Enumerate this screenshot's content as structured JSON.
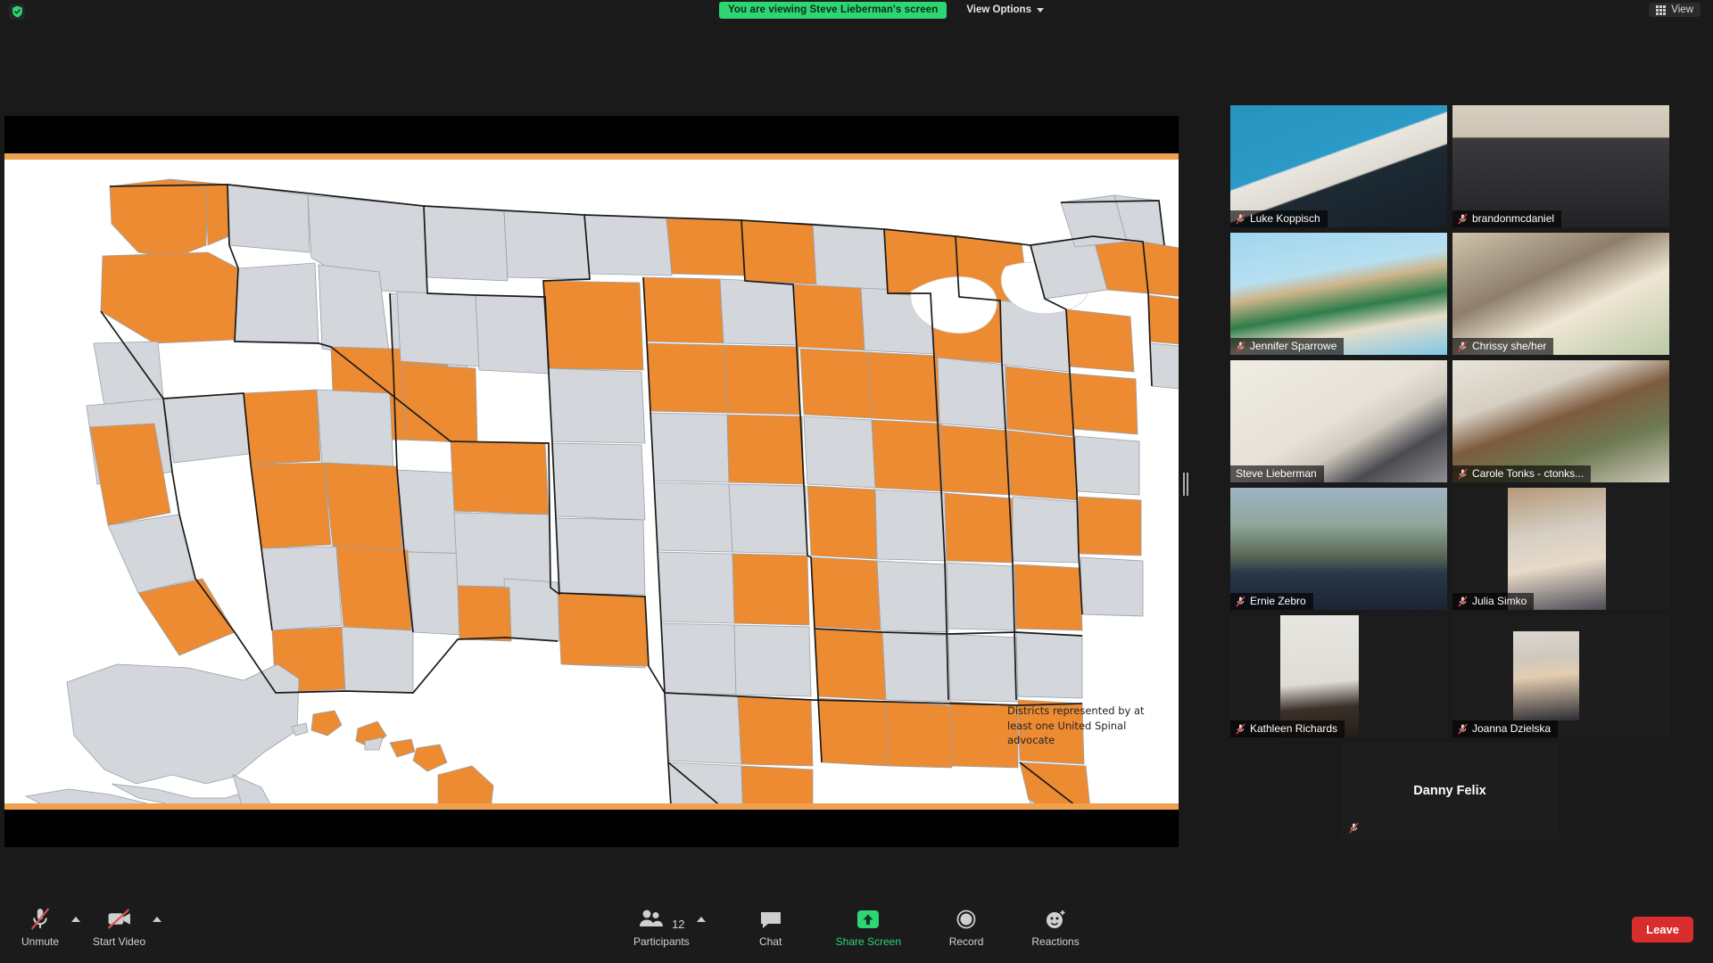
{
  "topbar": {
    "encryption_icon": "shield-check-icon",
    "viewing_banner": "You are viewing Steve Lieberman's screen",
    "view_options_label": "View Options",
    "view_options_icon": "chevron-down-icon",
    "view_button_label": "View",
    "view_button_icon": "grid-view-icon"
  },
  "share": {
    "slide": {
      "accent_color": "#F0A150",
      "district_color": "#ED8B33",
      "inactive_color": "#D3D7DC",
      "legend": {
        "swatch_color": "#ED8B33",
        "text": "Districts represented by at least one United Spinal advocate"
      }
    },
    "drag_handle_icon": "panel-resize-handle-icon"
  },
  "participants": {
    "rows": [
      [
        {
          "name": "Luke Koppisch",
          "muted": true,
          "speaking": false,
          "video": true,
          "style": "vid-luke"
        },
        {
          "name": "brandonmcdaniel",
          "muted": true,
          "speaking": false,
          "video": true,
          "style": "vid-brandon"
        }
      ],
      [
        {
          "name": "Jennifer Sparrowe",
          "muted": true,
          "speaking": true,
          "video": true,
          "style": "vid-jen"
        },
        {
          "name": "Chrissy she/her",
          "muted": true,
          "speaking": false,
          "video": true,
          "style": "vid-chrissy"
        }
      ],
      [
        {
          "name": "Steve Lieberman",
          "muted": false,
          "speaking": true,
          "video": true,
          "style": "vid-steve"
        },
        {
          "name": "Carole Tonks - ctonks...",
          "muted": true,
          "speaking": false,
          "video": true,
          "style": "vid-carole"
        }
      ],
      [
        {
          "name": "Ernie Zebro",
          "muted": true,
          "speaking": false,
          "video": true,
          "style": "vid-ernie"
        },
        {
          "name": "Julia Simko",
          "muted": true,
          "speaking": false,
          "video": true,
          "style": "vid-julia"
        }
      ],
      [
        {
          "name": "Kathleen Richards",
          "muted": true,
          "speaking": false,
          "video": true,
          "style": "vid-kathleen"
        },
        {
          "name": "Joanna Dzielska",
          "muted": true,
          "speaking": false,
          "video": true,
          "style": "vid-joanna"
        }
      ]
    ],
    "last": {
      "name": "Danny Felix",
      "muted": true,
      "speaking": false,
      "video": false
    }
  },
  "toolbar": {
    "mute": {
      "label": "Unmute",
      "icon": "microphone-muted-icon",
      "caret_icon": "chevron-up-icon"
    },
    "video": {
      "label": "Start Video",
      "icon": "camera-off-icon",
      "caret_icon": "chevron-up-icon"
    },
    "participants": {
      "label": "Participants",
      "count": "12",
      "icon": "participants-icon",
      "caret_icon": "chevron-up-icon"
    },
    "chat": {
      "label": "Chat",
      "icon": "chat-bubble-icon"
    },
    "share_screen": {
      "label": "Share Screen",
      "icon": "share-screen-icon",
      "color": "#2ed573"
    },
    "record": {
      "label": "Record",
      "icon": "record-circle-icon"
    },
    "reactions": {
      "label": "Reactions",
      "icon": "reactions-smiley-icon"
    },
    "leave": {
      "label": "Leave",
      "color": "#d92d2d"
    }
  }
}
